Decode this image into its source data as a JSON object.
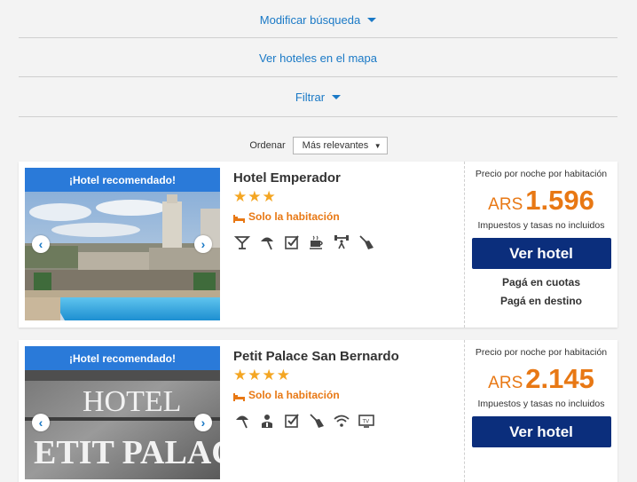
{
  "filters": {
    "modify_search": "Modificar búsqueda",
    "map": "Ver hoteles en el mapa",
    "filter": "Filtrar"
  },
  "order": {
    "label": "Ordenar",
    "selected": "Más relevantes"
  },
  "hotels": [
    {
      "badge": "¡Hotel recomendado!",
      "name": "Hotel Emperador",
      "stars": "★★★",
      "star_count": 3,
      "room": "Solo la habitación",
      "amenities": [
        "cocktail-icon",
        "beach-umbrella-icon",
        "checkbox-icon",
        "coffee-cup-icon",
        "gym-icon",
        "cleaning-icon"
      ],
      "price_label": "Precio por noche por habitación",
      "currency": "ARS",
      "price": "1.596",
      "tax_note": "Impuestos y tasas no incluidos",
      "button": "Ver hotel",
      "pay_installments": "Pagá en cuotas",
      "pay_destination": "Pagá en destino"
    },
    {
      "badge": "¡Hotel recomendado!",
      "name": "Petit Palace San Bernardo",
      "stars": "★★★★",
      "star_count": 4,
      "room": "Solo la habitación",
      "amenities": [
        "beach-umbrella-icon",
        "concierge-icon",
        "checkbox-icon",
        "cleaning-icon",
        "wifi-icon",
        "tv-icon"
      ],
      "price_label": "Precio por noche por habitación",
      "currency": "ARS",
      "price": "2.145",
      "tax_note": "Impuestos y tasas no incluidos",
      "button": "Ver hotel",
      "photo_text_1": "HOTEL",
      "photo_text_2": "ETIT PALAC"
    }
  ],
  "colors": {
    "link": "#1a79c6",
    "badge": "#2a7ad9",
    "price": "#e87814",
    "button": "#0b2e7c",
    "star": "#f4a623"
  }
}
